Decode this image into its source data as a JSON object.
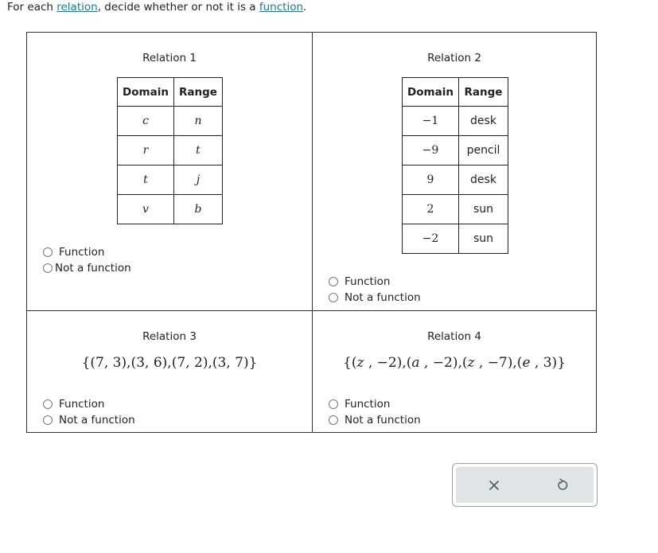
{
  "prompt": {
    "before": "For each ",
    "link1": "relation",
    "middle": ", decide whether or not it is a ",
    "link2": "function",
    "after": "."
  },
  "relations": [
    {
      "title": "Relation 1",
      "type": "table",
      "headers": [
        "Domain",
        "Range"
      ],
      "rows": [
        [
          "c",
          "n"
        ],
        [
          "r",
          "t"
        ],
        [
          "t",
          "j"
        ],
        [
          "v",
          "b"
        ]
      ],
      "options": [
        "Function",
        "Not a function"
      ]
    },
    {
      "title": "Relation 2",
      "type": "table",
      "headers": [
        "Domain",
        "Range"
      ],
      "rows": [
        [
          "−1",
          "desk"
        ],
        [
          "−9",
          "pencil"
        ],
        [
          "9",
          "desk"
        ],
        [
          "2",
          "sun"
        ],
        [
          "−2",
          "sun"
        ]
      ],
      "options": [
        "Function",
        "Not a function"
      ]
    },
    {
      "title": "Relation 3",
      "type": "set",
      "pairs": [
        [
          "7",
          "3"
        ],
        [
          "3",
          "6"
        ],
        [
          "7",
          "2"
        ],
        [
          "3",
          "7"
        ]
      ],
      "options": [
        "Function",
        "Not a function"
      ]
    },
    {
      "title": "Relation 4",
      "type": "set",
      "pairs": [
        [
          "z",
          "−2"
        ],
        [
          "a",
          "−2"
        ],
        [
          "z",
          "−7"
        ],
        [
          "e",
          "3"
        ]
      ],
      "options": [
        "Function",
        "Not a function"
      ]
    }
  ],
  "actions": {
    "clear_icon": "x-icon",
    "reset_icon": "undo-icon"
  },
  "colors": {
    "link": "#1f7a8c",
    "action_bg": "#dfe5e7",
    "icon": "#4a5a63"
  }
}
